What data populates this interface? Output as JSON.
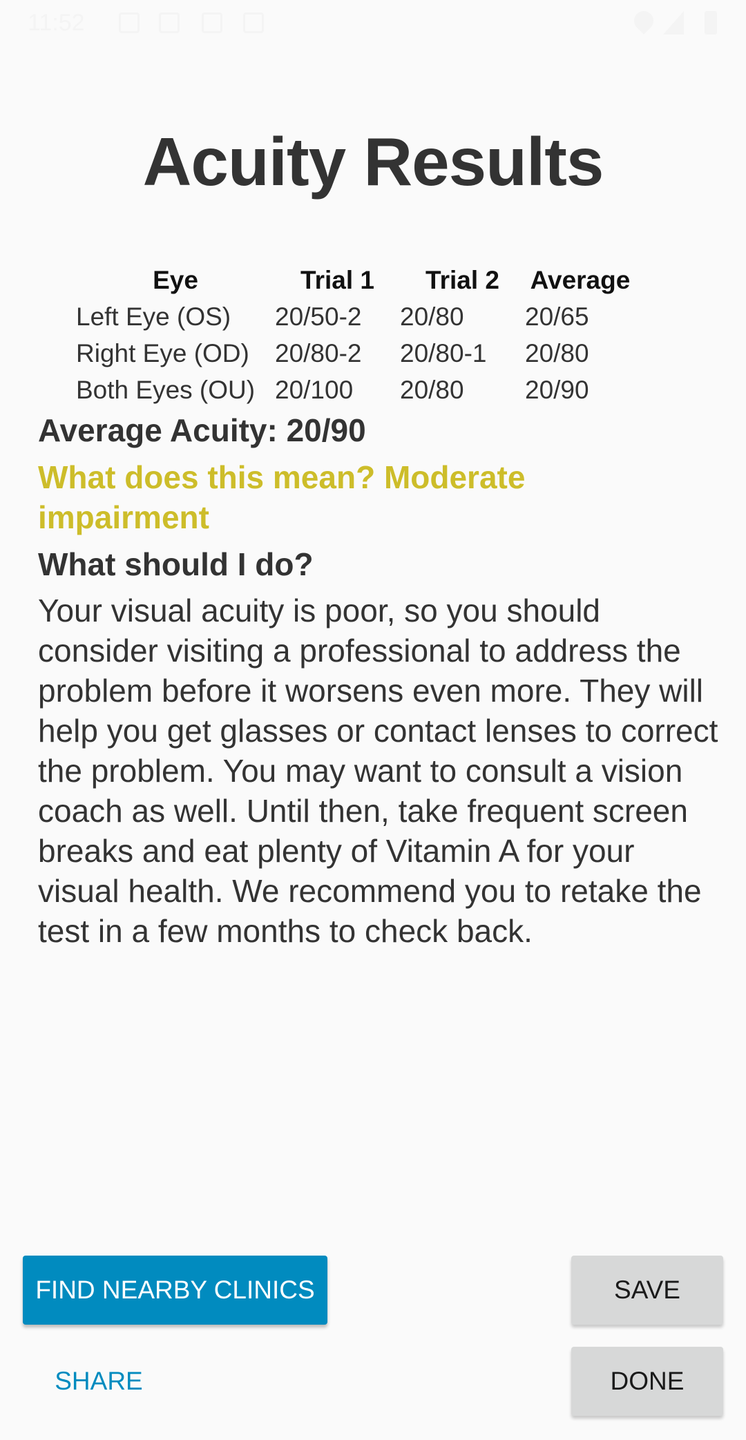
{
  "status_bar": {
    "time": "11:52"
  },
  "title": "Acuity Results",
  "table": {
    "headers": [
      "Eye",
      "Trial 1",
      "Trial 2",
      "Average"
    ],
    "rows": [
      [
        "Left Eye (OS)",
        "20/50-2",
        "20/80",
        "20/65"
      ],
      [
        "Right Eye (OD)",
        "20/80-2",
        "20/80-1",
        "20/80"
      ],
      [
        "Both Eyes (OU)",
        "20/100",
        "20/80",
        "20/90"
      ]
    ]
  },
  "average_acuity": "Average Acuity: 20/90",
  "meaning": "What does this mean? Moderate impairment",
  "todo_heading": "What should I do?",
  "advice": "Your visual acuity is poor, so you should consider visiting a professional to address the problem before it worsens even more. They will help you get glasses or contact lenses to correct the problem. You may want to consult a vision coach as well. Until then, take frequent screen breaks and eat plenty of Vitamin A for your visual health. We recommend you to retake the test in a few months to check back.",
  "buttons": {
    "find_clinics": "FIND NEARBY CLINICS",
    "save": "SAVE",
    "share": "SHARE",
    "done": "DONE"
  },
  "colors": {
    "primary": "#018bbf",
    "meaning_text": "#cdbd2a",
    "secondary_button": "#d7d8d8",
    "text": "#333333",
    "background": "#fafafa"
  }
}
